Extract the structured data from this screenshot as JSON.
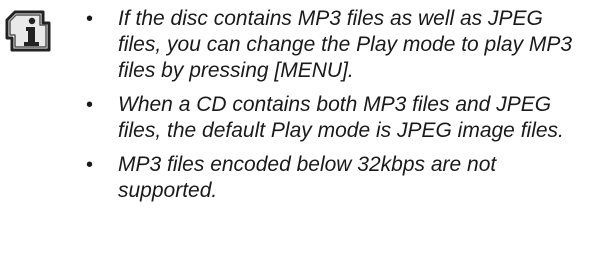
{
  "icon": "info-icon",
  "notes": [
    {
      "bullet": "•",
      "text": "If the disc contains MP3 files as well as JPEG files, you can change the Play mode to play MP3 files by pressing [MENU]."
    },
    {
      "bullet": "•",
      "text": "When a CD contains both MP3 files and JPEG files, the default Play mode is JPEG image files."
    },
    {
      "bullet": "•",
      "text": "MP3 files encoded below 32kbps are not supported."
    }
  ]
}
